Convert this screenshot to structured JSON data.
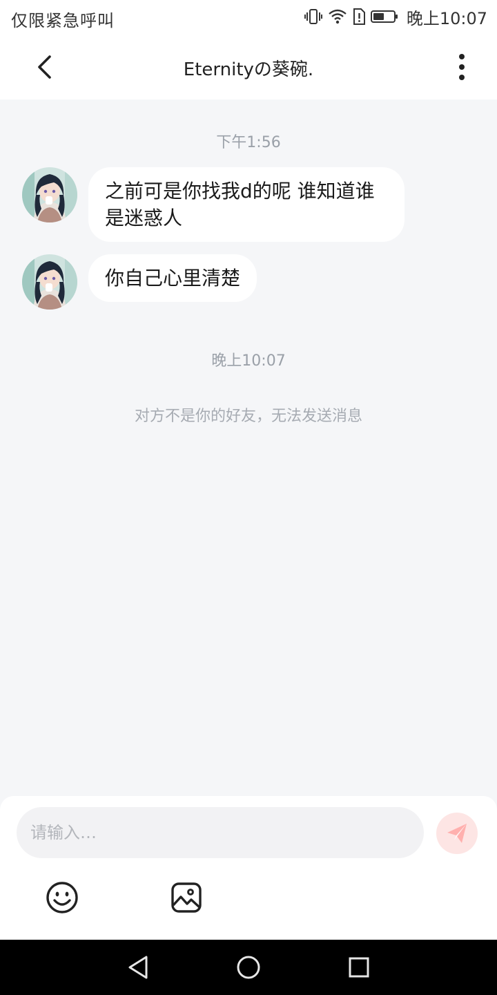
{
  "status_bar": {
    "left_text": "仅限紧急呼叫",
    "time": "晚上10:07",
    "icons": [
      "vibrate-icon",
      "wifi-icon",
      "sim-alert-icon",
      "battery-icon"
    ]
  },
  "header": {
    "title": "Eternityの葵碗.",
    "back_icon": "chevron-left-icon",
    "more_icon": "more-vertical-icon"
  },
  "chat": {
    "time_labels": [
      "下午1:56",
      "晚上10:07"
    ],
    "messages": [
      {
        "sender": "other",
        "text": "之前可是你找我d的呢 谁知道谁是迷惑人"
      },
      {
        "sender": "other",
        "text": "你自己心里清楚"
      }
    ],
    "notice": "对方不是你的好友，无法发送消息"
  },
  "input": {
    "placeholder": "请输入…",
    "value": "",
    "send_icon": "paper-plane-icon",
    "tools": [
      "emoji-icon",
      "image-icon"
    ]
  },
  "colors": {
    "background": "#f5f6f8",
    "bubble": "#ffffff",
    "send_button": "#fde5e4",
    "send_icon": "#ff9a98"
  },
  "nav_bar": {
    "buttons": [
      "back-triangle-icon",
      "home-circle-icon",
      "recents-square-icon"
    ]
  }
}
